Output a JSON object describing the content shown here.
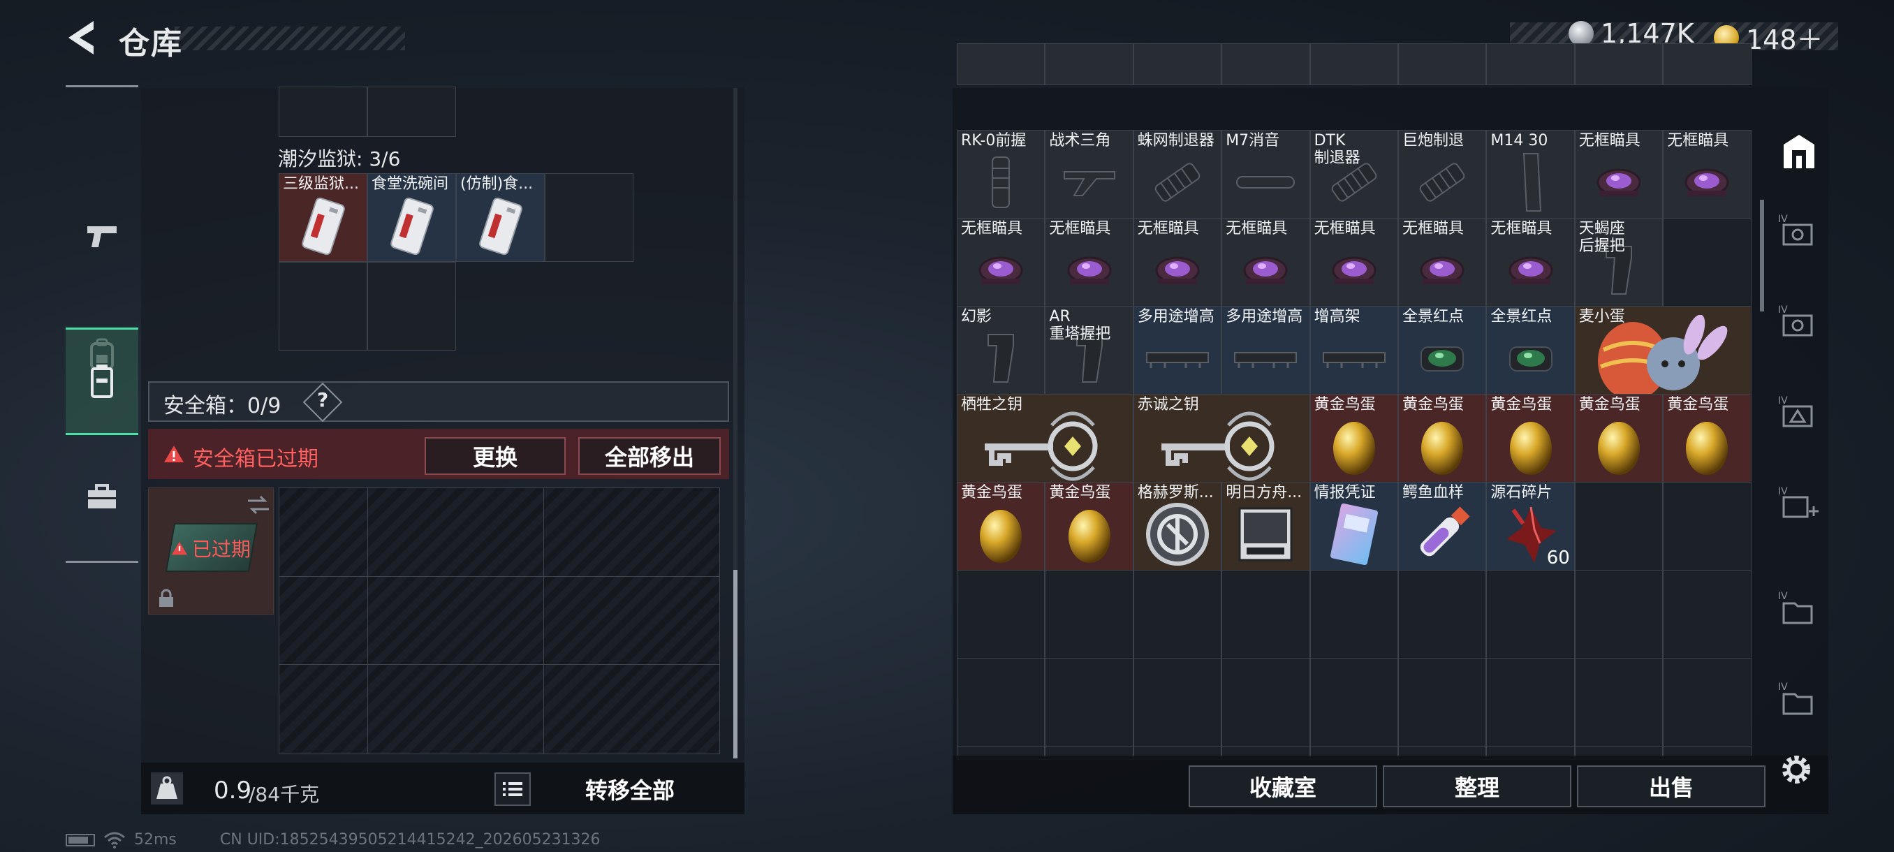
{
  "header": {
    "title": "仓库",
    "silver": "1,147K",
    "gold": "148＋"
  },
  "left": {
    "container_label": "潮汐监狱: 3/6",
    "items": [
      {
        "label": "三级监狱...",
        "bg": "red"
      },
      {
        "label": "食堂洗碗间",
        "bg": "blue"
      },
      {
        "label": "(仿制)食...",
        "bg": "blue"
      }
    ],
    "safebox": {
      "label": "安全箱：0/9",
      "help": "?",
      "warning": "安全箱已过期",
      "replace": "更换",
      "remove_all": "全部移出",
      "expired": "已过期"
    },
    "footer": {
      "weight": "0.9",
      "weight_max": "/84千克",
      "transfer_all": "转移全部"
    }
  },
  "grid": {
    "rows": [
      [
        {
          "label": "RK-0前握",
          "bg": "grey",
          "icon": "foregrip-icon"
        },
        {
          "label": "战术三角",
          "bg": "grey",
          "icon": "angled-grip-icon"
        },
        {
          "label": "蛛网制退器",
          "bg": "grey",
          "icon": "muzzle-brake-icon"
        },
        {
          "label": "M7消音",
          "bg": "grey",
          "icon": "suppressor-icon"
        },
        {
          "label": "DTK\n制退器",
          "bg": "grey",
          "icon": "muzzle-brake-icon"
        },
        {
          "label": "巨炮制退",
          "bg": "grey",
          "icon": "muzzle-brake-icon"
        },
        {
          "label": "M14 30",
          "bg": "grey",
          "icon": "magazine-icon"
        },
        {
          "label": "无框瞄具",
          "bg": "grey",
          "icon": "red-dot-sight-icon"
        },
        {
          "label": "无框瞄具",
          "bg": "grey",
          "icon": "red-dot-sight-icon"
        }
      ],
      [
        {
          "label": "无框瞄具",
          "bg": "grey",
          "icon": "red-dot-sight-icon"
        },
        {
          "label": "无框瞄具",
          "bg": "grey",
          "icon": "red-dot-sight-icon"
        },
        {
          "label": "无框瞄具",
          "bg": "grey",
          "icon": "red-dot-sight-icon"
        },
        {
          "label": "无框瞄具",
          "bg": "grey",
          "icon": "red-dot-sight-icon"
        },
        {
          "label": "无框瞄具",
          "bg": "grey",
          "icon": "red-dot-sight-icon"
        },
        {
          "label": "无框瞄具",
          "bg": "grey",
          "icon": "red-dot-sight-icon"
        },
        {
          "label": "无框瞄具",
          "bg": "grey",
          "icon": "red-dot-sight-icon"
        },
        {
          "label": "天蝎座\n后握把",
          "bg": "grey",
          "icon": "pistol-grip-icon"
        }
      ],
      [
        {
          "label": "幻影",
          "bg": "grey",
          "icon": "pistol-grip-icon"
        },
        {
          "label": "AR\n重塔握把",
          "bg": "grey",
          "icon": "pistol-grip-icon"
        },
        {
          "label": "多用途增高",
          "bg": "blue",
          "icon": "riser-mount-icon"
        },
        {
          "label": "多用途增高",
          "bg": "blue",
          "icon": "riser-mount-icon"
        },
        {
          "label": "增高架",
          "bg": "blue",
          "icon": "riser-mount-icon"
        },
        {
          "label": "全景红点",
          "bg": "blue",
          "icon": "panoramic-sight-icon"
        },
        {
          "label": "全景红点",
          "bg": "blue",
          "icon": "panoramic-sight-icon"
        },
        {
          "label": "麦小蛋",
          "bg": "brown",
          "icon": "bunny-egg-plush-icon"
        }
      ],
      [
        {
          "label": "栖牲之钥",
          "bg": "brown",
          "icon": "ornate-key-icon"
        },
        {
          "label": "赤诚之钥",
          "bg": "brown",
          "icon": "ornate-key-icon"
        },
        {
          "label": "黄金鸟蛋",
          "bg": "red",
          "icon": "golden-egg-icon"
        },
        {
          "label": "黄金鸟蛋",
          "bg": "red",
          "icon": "golden-egg-icon"
        },
        {
          "label": "黄金鸟蛋",
          "bg": "red",
          "icon": "golden-egg-icon"
        },
        {
          "label": "黄金鸟蛋",
          "bg": "red",
          "icon": "golden-egg-icon"
        },
        {
          "label": "黄金鸟蛋",
          "bg": "red",
          "icon": "golden-egg-icon"
        }
      ],
      [
        {
          "label": "黄金鸟蛋",
          "bg": "red",
          "icon": "golden-egg-icon"
        },
        {
          "label": "黄金鸟蛋",
          "bg": "red",
          "icon": "golden-egg-icon"
        },
        {
          "label": "格赫罗斯...",
          "bg": "brown",
          "icon": "medallion-icon"
        },
        {
          "label": "明日方舟...",
          "bg": "brown",
          "icon": "album-icon"
        },
        {
          "label": "情报凭证",
          "bg": "blue",
          "icon": "intel-card-icon"
        },
        {
          "label": "鳄鱼血样",
          "bg": "blue",
          "icon": "blood-sample-icon"
        },
        {
          "label": "源石碎片",
          "bg": "blue",
          "icon": "originium-shard-icon",
          "qty": "60"
        }
      ]
    ]
  },
  "bottom_buttons": {
    "collection": "收藏室",
    "sort": "整理",
    "sell": "出售"
  },
  "status": {
    "ping": "52ms",
    "uid": "CN UID:18525439505214415242_202605231326"
  },
  "colors": {
    "accent": "#4be0a8",
    "warning": "#e84848",
    "gold": "#d9a92a"
  }
}
